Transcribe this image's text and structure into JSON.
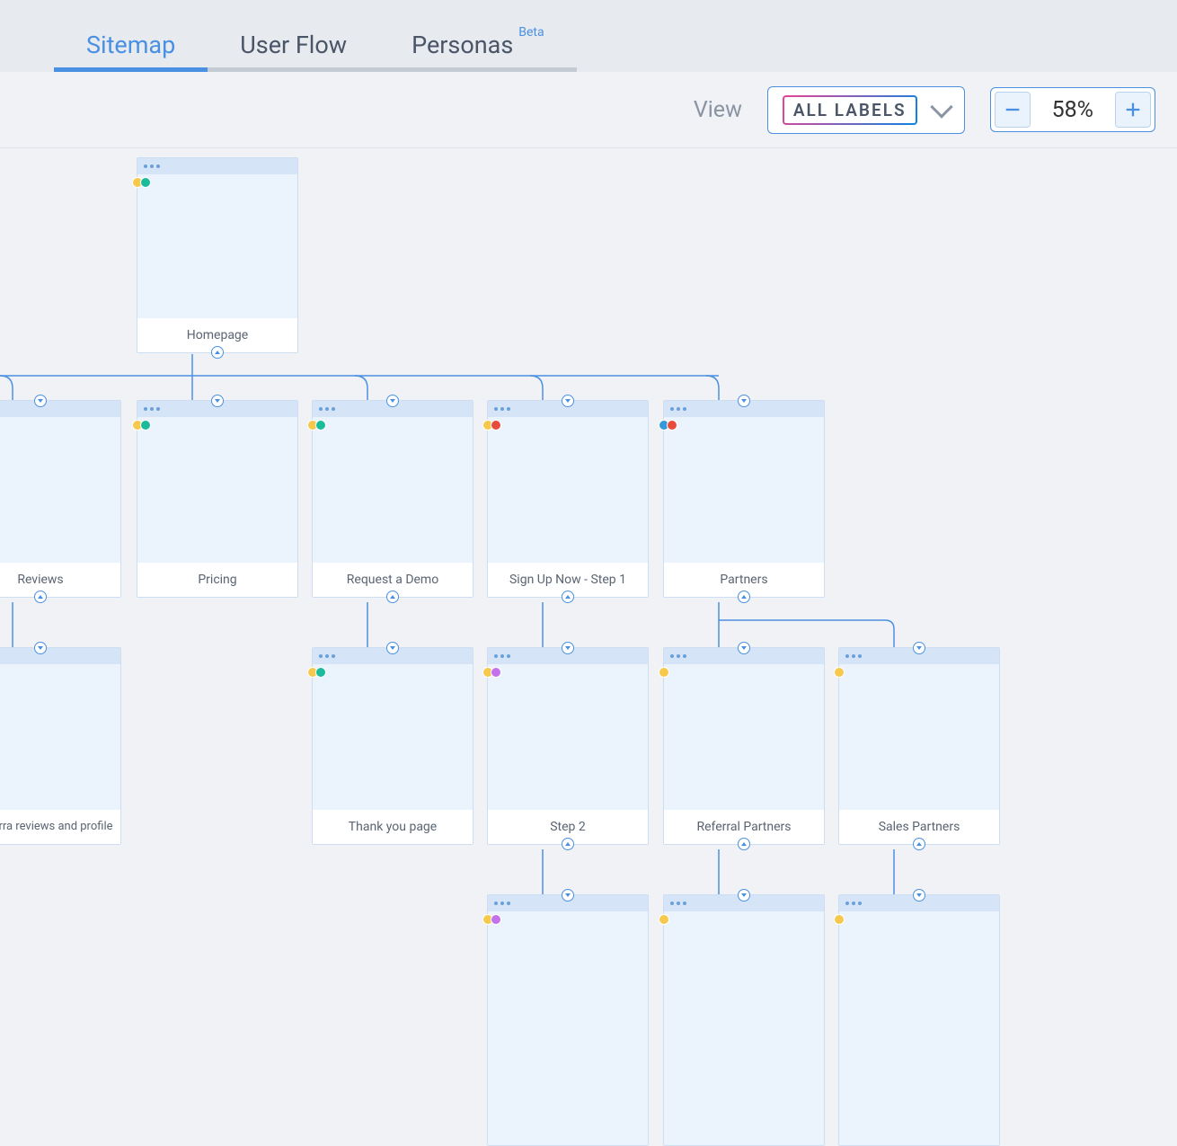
{
  "tabs": {
    "sitemap": "Sitemap",
    "userflow": "User Flow",
    "personas": "Personas",
    "beta": "Beta"
  },
  "toolbar": {
    "view_label": "View",
    "labels_filter": "ALL LABELS",
    "zoom_value": "58%"
  },
  "cards": {
    "homepage": "Homepage",
    "reviews": "Reviews",
    "pricing": "Pricing",
    "request_demo": "Request a Demo",
    "signup_step1": "Sign Up Now - Step 1",
    "partners": "Partners",
    "capterra": "Capterra reviews and profile",
    "thankyou": "Thank you page",
    "step2": "Step 2",
    "referral_partners": "Referral Partners",
    "sales_partners": "Sales Partners"
  },
  "tag_colors": {
    "yellow": "#f6c84c",
    "green": "#1abc9c",
    "blue": "#3498db",
    "red": "#e74c3c",
    "purple": "#c471ed"
  }
}
